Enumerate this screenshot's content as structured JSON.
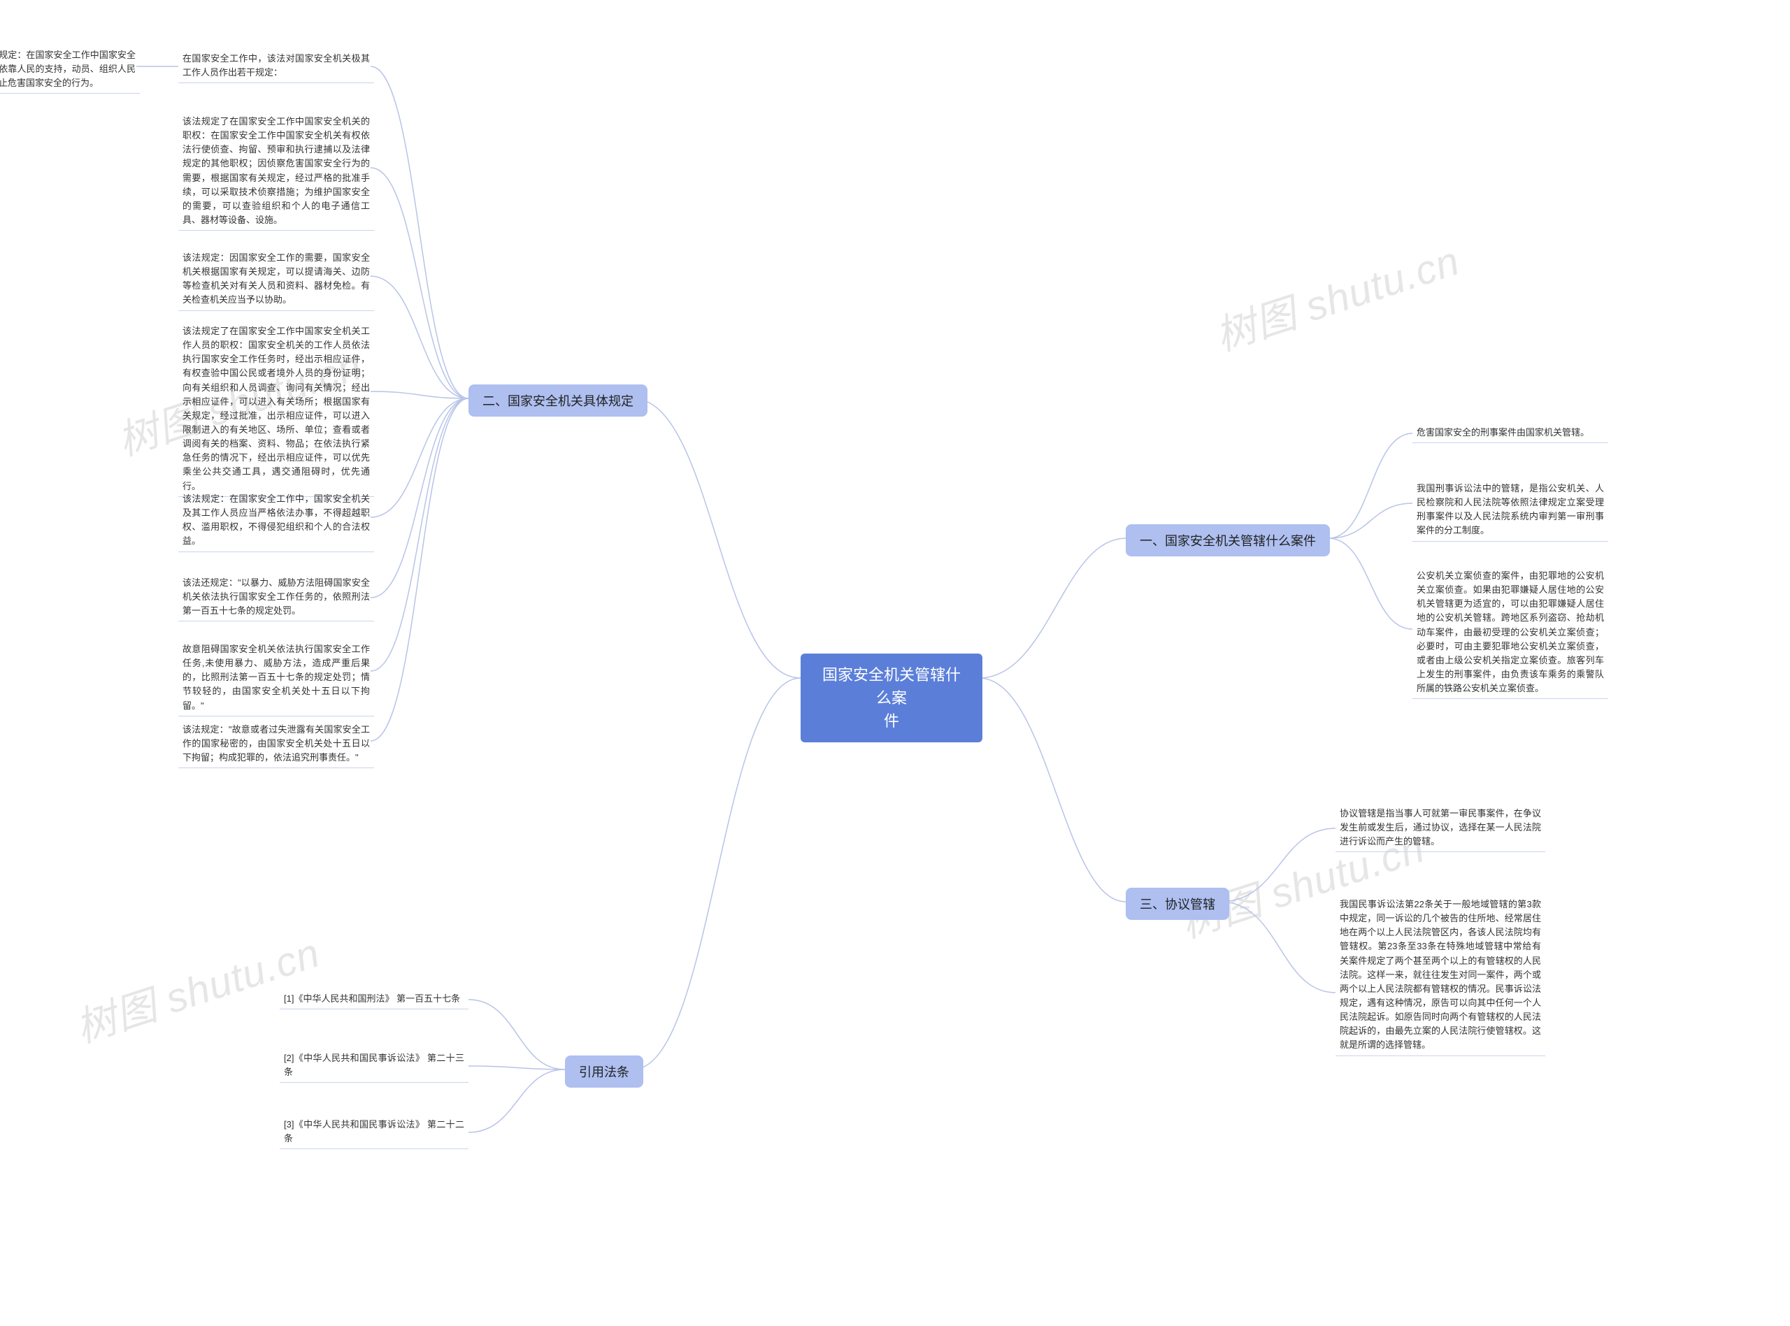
{
  "watermark": "树图 shutu.cn",
  "root": {
    "line1": "国家安全机关管辖什么案",
    "line2": "件"
  },
  "right": {
    "branch1": {
      "label": "一、国家安全机关管辖什么案件",
      "leaves": [
        "危害国家安全的刑事案件由国家机关管辖。",
        "我国刑事诉讼法中的管辖，是指公安机关、人民检察院和人民法院等依照法律规定立案受理刑事案件以及人民法院系统内审判第一审刑事案件的分工制度。",
        "公安机关立案侦查的案件，由犯罪地的公安机关立案侦查。如果由犯罪嫌疑人居住地的公安机关管辖更为适宜的，可以由犯罪嫌疑人居住地的公安机关管辖。跨地区系列盗窃、抢劫机动车案件，由最初受理的公安机关立案侦查；必要时，可由主要犯罪地公安机关立案侦查，或者由上级公安机关指定立案侦查。旅客列车上发生的刑事案件，由负责该车乘务的乘警队所属的铁路公安机关立案侦查。"
      ]
    },
    "branch3": {
      "label": "三、协议管辖",
      "leaves": [
        "协议管辖是指当事人可就第一审民事案件，在争议发生前或发生后，通过协议，选择在某一人民法院进行诉讼而产生的管辖。",
        "我国民事诉讼法第22条关于一般地域管辖的第3款中规定，同一诉讼的几个被告的住所地、经常居住地在两个以上人民法院管区内，各该人民法院均有管辖权。第23条至33条在特殊地域管辖中常给有关案件规定了两个甚至两个以上的有管辖权的人民法院。这样一来，就往往发生对同一案件，两个或两个以上人民法院都有管辖权的情况。民事诉讼法规定，遇有这种情况，原告可以向其中任何一个人民法院起诉。如原告同时向两个有管辖权的人民法院起诉的，由最先立案的人民法院行使管辖权。这就是所谓的选择管辖。"
      ]
    }
  },
  "left": {
    "branch2": {
      "label": "二、国家安全机关具体规定",
      "leaves": [
        "在国家安全工作中，该法对国家安全机关极其工作人员作出若干规定：",
        "该法规定了在国家安全工作中国家安全机关的职权：在国家安全工作中国家安全机关有权依法行使侦查、拘留、预审和执行逮捕以及法律规定的其他职权；因侦察危害国家安全行为的需要，根据国家有关规定，经过严格的批准手续，可以采取技术侦察措施；为维护国家安全的需要，可以查验组织和个人的电子通信工具、器材等设备、设施。",
        "该法规定：因国家安全工作的需要，国家安全机关根据国家有关规定，可以提请海关、边防等检查机关对有关人员和资料、器材免检。有关检查机关应当予以协助。",
        "该法规定了在国家安全工作中国家安全机关工作人员的职权：国家安全机关的工作人员依法执行国家安全工作任务时，经出示相应证件，有权查验中国公民或者境外人员的身份证明；向有关组织和人员调查、询问有关情况；经出示相应证件，可以进入有关场所；根据国家有关规定，经过批准，出示相应证件，可以进入限制进入的有关地区、场所、单位；查看或者调阅有关的档案、资料、物品；在依法执行紧急任务的情况下，经出示相应证件，可以优先乘坐公共交通工具，遇交通阻碍时，优先通行。",
        "该法规定：在国家安全工作中，国家安全机关及其工作人员应当严格依法办事，不得超越职权、滥用职权，不得侵犯组织和个人的合法权益。",
        "该法还规定：\"以暴力、威胁方法阻碍国家安全机关依法执行国家安全工作任务的，依照刑法第一百五十七条的规定处罚。",
        "故意阻碍国家安全机关依法执行国家安全工作任务,未使用暴力、威胁方法，造成严重后果的，比照刑法第一百五十七条的规定处罚；情节较轻的，由国家安全机关处十五日以下拘留。\"",
        "该法规定：\"故意或者过失泄露有关国家安全工作的国家秘密的，由国家安全机关处十五日以下拘留；构成犯罪的，依法追究刑事责任。\""
      ],
      "subleaf": "例如该法规定：在国家安全工作中国家安全机关必须依靠人民的支持，动员、组织人民防范、制止危害国家安全的行为。"
    },
    "branch4": {
      "label": "引用法条",
      "leaves": [
        "[1]《中华人民共和国刑法》 第一百五十七条",
        "[2]《中华人民共和国民事诉讼法》 第二十三条",
        "[3]《中华人民共和国民事诉讼法》 第二十二条"
      ]
    }
  }
}
